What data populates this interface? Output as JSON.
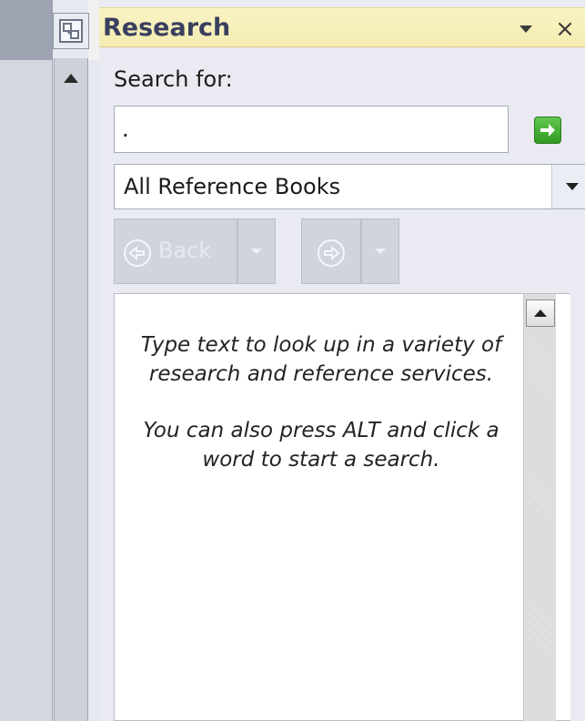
{
  "pane": {
    "title": "Research",
    "menu_icon": "dropdown-triangle-icon",
    "close_glyph": "×"
  },
  "search": {
    "label": "Search for:",
    "value": ".",
    "go_icon": "green-arrow-icon"
  },
  "source": {
    "selected": "All Reference Books"
  },
  "nav": {
    "back_label": "Back",
    "back_icon": "left-circle-arrow-icon",
    "forward_icon": "right-circle-arrow-icon"
  },
  "results": {
    "message_1": "Type text to look up in a variety of research and reference services.",
    "message_2": "You can also press ALT and click a word to start a search."
  },
  "colors": {
    "header_bg": "#f6eeb9",
    "title_text": "#3a3f5e",
    "go_green": "#3fae30"
  }
}
